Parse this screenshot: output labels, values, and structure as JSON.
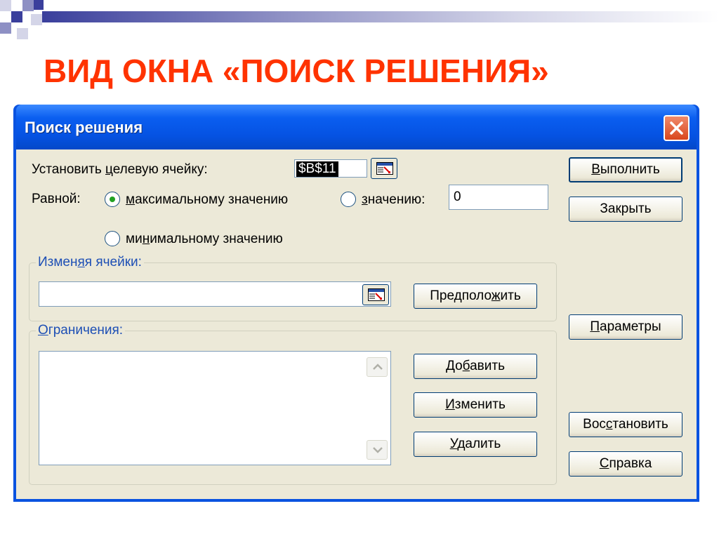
{
  "slide": {
    "title": "ВИД ОКНА «ПОИСК РЕШЕНИЯ»",
    "accent_color": "#ff3300"
  },
  "window": {
    "title": "Поиск решения",
    "close_icon": "close-icon"
  },
  "target": {
    "label_pre": "Установить ",
    "label_u": "ц",
    "label_post": "елевую ячейку:",
    "value": "$B$11"
  },
  "equal": {
    "label": "Равной:",
    "max": {
      "pre": "",
      "u": "м",
      "post": "аксимальному значению",
      "selected": true
    },
    "value_option": {
      "pre": "",
      "u": "з",
      "post": "начению:",
      "selected": false
    },
    "value_input": "0",
    "min": {
      "pre": "ми",
      "u": "н",
      "post": "имальному значению",
      "selected": false
    }
  },
  "changing": {
    "label_pre": "Измен",
    "label_u": "я",
    "label_post": "я ячейки:",
    "value": "",
    "guess_button": {
      "pre": "Предполо",
      "u": "ж",
      "post": "ить"
    }
  },
  "constraints": {
    "label_pre": "",
    "label_u": "О",
    "label_post": "граничения:",
    "items": [],
    "add_button": {
      "pre": "До",
      "u": "б",
      "post": "авить"
    },
    "change_button": {
      "pre": "",
      "u": "И",
      "post": "зменить"
    },
    "delete_button": {
      "pre": "",
      "u": "У",
      "post": "далить"
    }
  },
  "side_buttons": {
    "solve": {
      "pre": "",
      "u": "В",
      "post": "ыполнить"
    },
    "close": {
      "pre": "",
      "u": "",
      "post": "Закрыть"
    },
    "options": {
      "pre": "",
      "u": "П",
      "post": "араметры"
    },
    "reset": {
      "pre": "Вос",
      "u": "с",
      "post": "тановить"
    },
    "help": {
      "pre": "",
      "u": "С",
      "post": "правка"
    }
  }
}
